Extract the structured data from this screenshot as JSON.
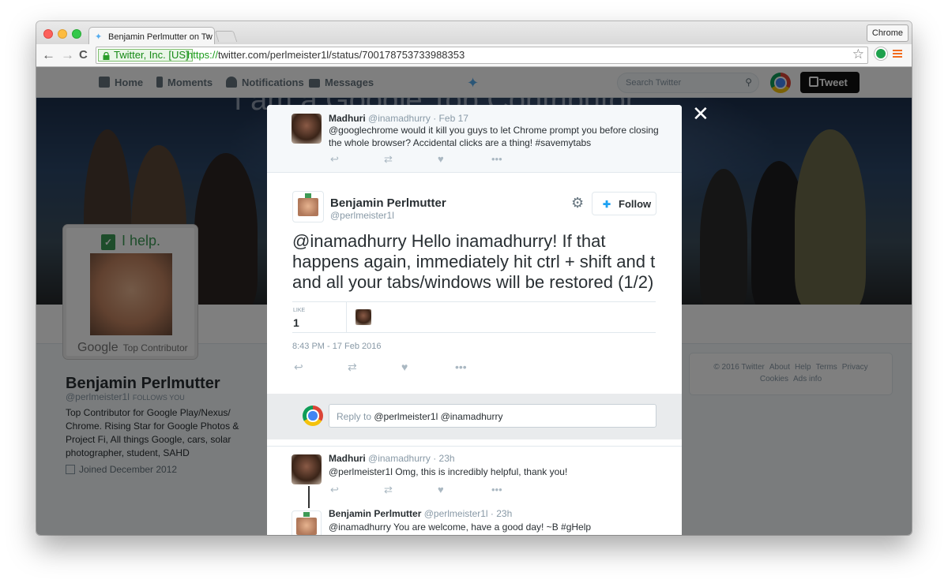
{
  "browser": {
    "tab_title": "Benjamin Perlmutter on Tw",
    "tab_close": "×",
    "profile_button": "Chrome",
    "ev_label": "Twitter, Inc. [US]",
    "url_scheme": "https://",
    "url_host": "twitter.com",
    "url_path": "/perlmeister1l/status/700178753733988353",
    "star": "☆",
    "back": "←",
    "forward": "→",
    "reload": "C"
  },
  "twitter_nav": {
    "home": "Home",
    "moments": "Moments",
    "notifications": "Notifications",
    "messages": "Messages",
    "search_placeholder": "Search Twitter",
    "tweet_button": "Tweet"
  },
  "profile": {
    "badge": "I help.",
    "google_label": "Google",
    "top_contributor": "Top Contributor",
    "name": "Benjamin Perlmutter",
    "handle": "@perlmeister1l",
    "follows_you": "FOLLOWS YOU",
    "bio": "Top Contributor for Google Play/Nexus/ Chrome. Rising Star for Google Photos & Project Fi, All things Google, cars, solar photographer, student, SAHD",
    "joined": "Joined December 2012",
    "banner_text": "I am a Google Top Contributor"
  },
  "footer": {
    "copyright": "© 2016 Twitter",
    "about": "About",
    "help": "Help",
    "terms": "Terms",
    "privacy": "Privacy",
    "cookies": "Cookies",
    "ads_info": "Ads info"
  },
  "modal": {
    "close": "✕",
    "ancestor": {
      "name": "Madhuri",
      "meta": "@inamadhurry · Feb 17",
      "text": "@googlechrome would it kill you guys to let Chrome prompt you before closing the whole browser? Accidental clicks are a thing! #savemytabs"
    },
    "main": {
      "name": "Benjamin Perlmutter",
      "handle": "@perlmeister1l",
      "follow": "Follow",
      "text": "@inamadhurry Hello inamadhurry! If that happens again, immediately hit ctrl + shift and t and all your tabs/windows will be restored (1/2)",
      "like_label": "LIKE",
      "like_count": "1",
      "date": "8:43 PM - 17 Feb 2016"
    },
    "reply": {
      "prefix": "Reply to",
      "to": "@perlmeister1l @inamadhurry"
    },
    "replies": [
      {
        "name": "Madhuri",
        "meta": "@inamadhurry · 23h",
        "text": "@perlmeister1l Omg, this is incredibly helpful, thank you!"
      },
      {
        "name": "Benjamin Perlmutter",
        "meta": "@perlmeister1l · 23h",
        "text": "@inamadhurry You are welcome, have a good day! ~B #gHelp"
      }
    ],
    "action_icons": {
      "reply": "↩",
      "retweet": "⇄",
      "like": "♥",
      "more": "•••"
    }
  }
}
